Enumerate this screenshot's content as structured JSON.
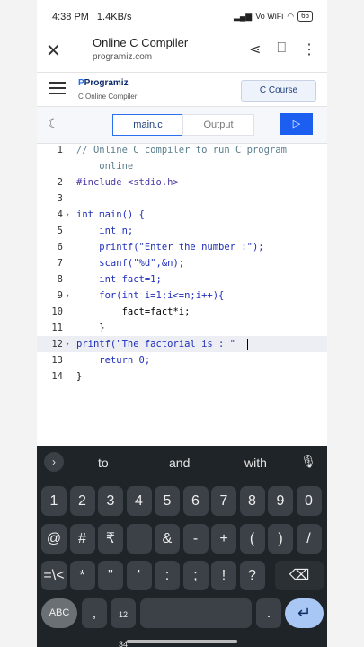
{
  "status_bar": {
    "time_speed": "4:38 PM | 1.4KB/s",
    "network": "Vo WiFi",
    "battery": "66"
  },
  "browser": {
    "title": "Online C Compiler",
    "url": "programiz.com"
  },
  "site": {
    "logo": "Programiz",
    "logo_sub": "C Online Compiler",
    "course_button": "C Course"
  },
  "tabs": {
    "main": "main.c",
    "output": "Output",
    "run_icon": "play-icon"
  },
  "editor": {
    "lines": [
      {
        "num": "1",
        "text": "// Online C compiler to run C program"
      },
      {
        "num": "",
        "text": "    online"
      },
      {
        "num": "2",
        "text": "#include <stdio.h>"
      },
      {
        "num": "3",
        "text": ""
      },
      {
        "num": "4",
        "text": "int main() {"
      },
      {
        "num": "5",
        "text": "    int n;"
      },
      {
        "num": "6",
        "text": "    printf(\"Enter the number :\");"
      },
      {
        "num": "7",
        "text": "    scanf(\"%d\",&n);"
      },
      {
        "num": "8",
        "text": "    int fact=1;"
      },
      {
        "num": "9",
        "text": "    for(int i=1;i<=n;i++){"
      },
      {
        "num": "10",
        "text": "        fact=fact*i;"
      },
      {
        "num": "11",
        "text": "    }"
      },
      {
        "num": "12",
        "text": "printf(\"The factorial is : \""
      },
      {
        "num": "13",
        "text": "    return 0;"
      },
      {
        "num": "14",
        "text": "}"
      }
    ]
  },
  "keyboard": {
    "suggestions": [
      "to",
      "and",
      "with"
    ],
    "row_numbers": [
      "1",
      "2",
      "3",
      "4",
      "5",
      "6",
      "7",
      "8",
      "9",
      "0"
    ],
    "row_symbols1": [
      "@",
      "#",
      "₹",
      "_",
      "&",
      "-",
      "+",
      "(",
      ")",
      "/"
    ],
    "row_symbols2": [
      "=\\<",
      "*",
      "\"",
      "'",
      ":",
      ";",
      "!",
      "?"
    ],
    "abc_key": "ABC",
    "comma_key": ",",
    "numpad_key": "12\n34",
    "period_key": "."
  }
}
